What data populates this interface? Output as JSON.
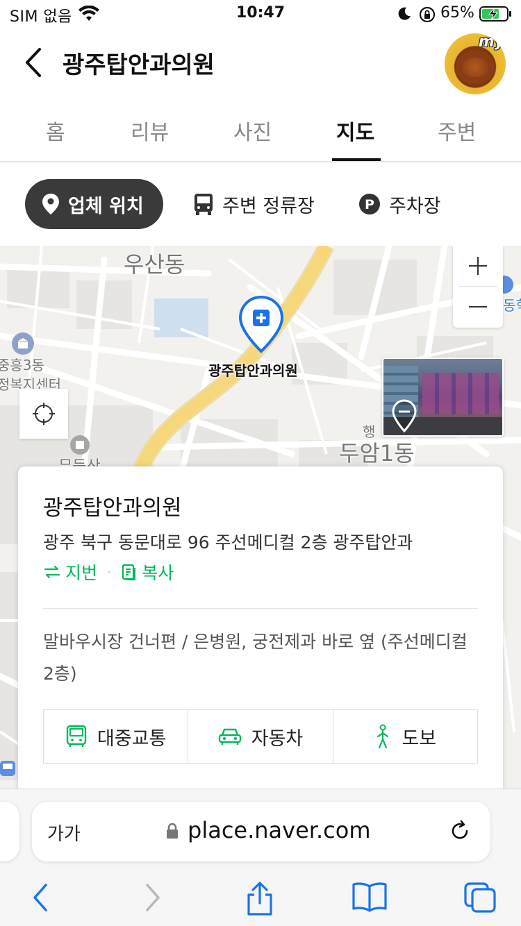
{
  "status_bar": {
    "carrier": "SIM 없음",
    "time": "10:47",
    "battery_percent": "65%",
    "icons": [
      "wifi-icon",
      "moon-icon",
      "rotation-lock-icon",
      "battery-charging-icon"
    ]
  },
  "header": {
    "title": "광주탑안과의원",
    "back_icon": "chevron-left-icon",
    "avatar_text": "my"
  },
  "tabs": [
    {
      "label": "홈",
      "active": false
    },
    {
      "label": "리뷰",
      "active": false
    },
    {
      "label": "사진",
      "active": false
    },
    {
      "label": "지도",
      "active": true
    },
    {
      "label": "주변",
      "active": false
    }
  ],
  "chips": [
    {
      "label": "업체 위치",
      "icon": "location-pin-icon",
      "active": true
    },
    {
      "label": "주변 정류장",
      "icon": "bus-icon",
      "active": false
    },
    {
      "label": "주차장",
      "icon": "parking-icon",
      "active": false
    }
  ],
  "map": {
    "labels": {
      "usan": "우산동",
      "jungheung_line1": "중흥3동",
      "jungheung_line2": "정복지센터",
      "duam": "두암1동",
      "haeng": "행",
      "mudeung": "무등산",
      "right_edge": "동힉"
    },
    "marker_label": "광주탑안과의원",
    "zoom_in": "+",
    "zoom_out": "—",
    "colors": {
      "main_road": "#f6d77c",
      "marker": "#1a73e8",
      "water": "#cfdff0"
    }
  },
  "card": {
    "name": "광주탑안과의원",
    "address": "광주 북구 동문대로 96 주선메디컬 2층 광주탑안과",
    "lot_number_label": "지번",
    "copy_label": "복사",
    "directions": "말바우시장 건너편 / 은병원, 궁전제과 바로 옆 (주선메디컬 2층)",
    "transport": [
      {
        "label": "대중교통",
        "icon": "bus-front-icon"
      },
      {
        "label": "자동차",
        "icon": "car-icon"
      },
      {
        "label": "도보",
        "icon": "walking-icon"
      }
    ],
    "accent_color": "#03b85a"
  },
  "safari": {
    "text_size_label": "가가",
    "url": "place.naver.com",
    "toolbar_icons": [
      "back-arrow-icon",
      "forward-arrow-icon",
      "share-icon",
      "bookmarks-icon",
      "tabs-icon"
    ]
  }
}
